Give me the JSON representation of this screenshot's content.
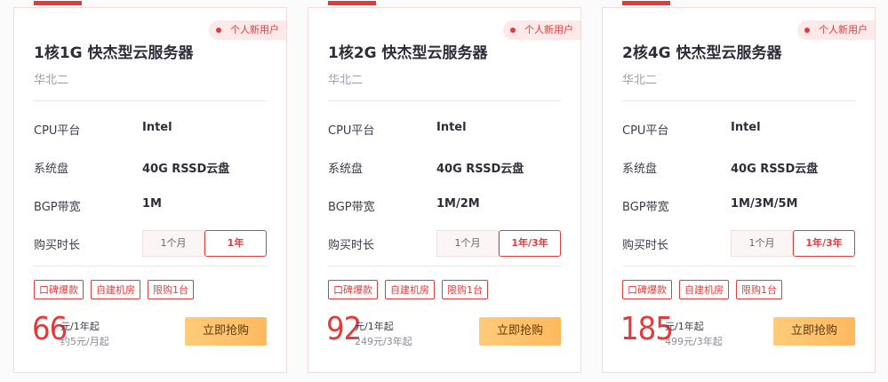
{
  "cards": [
    {
      "badge": "个人新用户",
      "title": "1核1G 快杰型云服务器",
      "region": "华北二",
      "specs": [
        {
          "label": "CPU平台",
          "value": "Intel"
        },
        {
          "label": "系统盘",
          "value": "40G RSSD云盘"
        },
        {
          "label": "BGP带宽",
          "value": "1M"
        }
      ],
      "period_label": "购买时长",
      "period_options": [
        "1个月",
        "1年"
      ],
      "period_selected": "1年",
      "tags": [
        "口碑爆款",
        "自建机房",
        "限购1台"
      ],
      "price": "66",
      "price_unit": "元/1年起",
      "price_sub": "约5元/月起",
      "buy_label": "立即抢购"
    },
    {
      "badge": "个人新用户",
      "title": "1核2G 快杰型云服务器",
      "region": "华北二",
      "specs": [
        {
          "label": "CPU平台",
          "value": "Intel"
        },
        {
          "label": "系统盘",
          "value": "40G RSSD云盘"
        },
        {
          "label": "BGP带宽",
          "value": "1M/2M"
        }
      ],
      "period_label": "购买时长",
      "period_options": [
        "1个月",
        "1年/3年"
      ],
      "period_selected": "1年/3年",
      "tags": [
        "口碑爆款",
        "自建机房",
        "限购1台"
      ],
      "price": "92",
      "price_unit": "元/1年起",
      "price_sub": "249元/3年起",
      "buy_label": "立即抢购"
    },
    {
      "badge": "个人新用户",
      "title": "2核4G 快杰型云服务器",
      "region": "华北二",
      "specs": [
        {
          "label": "CPU平台",
          "value": "Intel"
        },
        {
          "label": "系统盘",
          "value": "40G RSSD云盘"
        },
        {
          "label": "BGP带宽",
          "value": "1M/3M/5M"
        }
      ],
      "period_label": "购买时长",
      "period_options": [
        "1个月",
        "1年/3年"
      ],
      "period_selected": "1年/3年",
      "tags": [
        "口碑爆款",
        "自建机房",
        "限购1台"
      ],
      "price": "185",
      "price_unit": "元/1年起",
      "price_sub": "499元/3年起",
      "buy_label": "立即抢购"
    }
  ],
  "colors": {
    "accent": "#e33b3b",
    "button": "#ffc06b"
  }
}
